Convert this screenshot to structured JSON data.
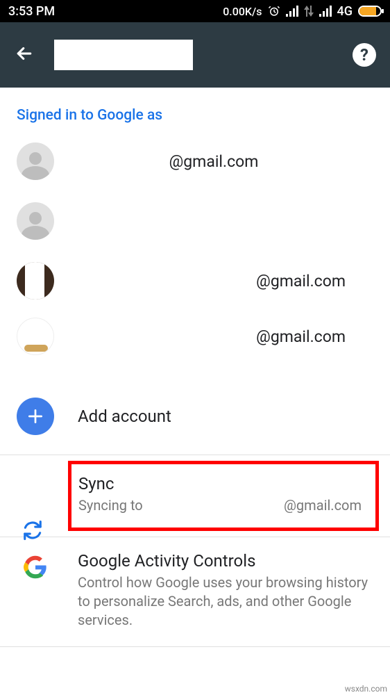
{
  "status": {
    "time": "3:53 PM",
    "speed": "0.00K/s",
    "network_label": "4G"
  },
  "header": {
    "heading": "Signed in to Google as"
  },
  "accounts": [
    {
      "email": "@gmail.com"
    },
    {
      "email": ""
    },
    {
      "email": "@gmail.com"
    },
    {
      "email": "@gmail.com"
    }
  ],
  "add": {
    "label": "Add account"
  },
  "sync": {
    "title": "Sync",
    "sub_prefix": "Syncing to",
    "sub_email": "@gmail.com"
  },
  "activity": {
    "title": "Google Activity Controls",
    "sub": "Control how Google uses your browsing history to personalize Search, ads, and other Google services."
  },
  "attribution": "wsxdn.com"
}
